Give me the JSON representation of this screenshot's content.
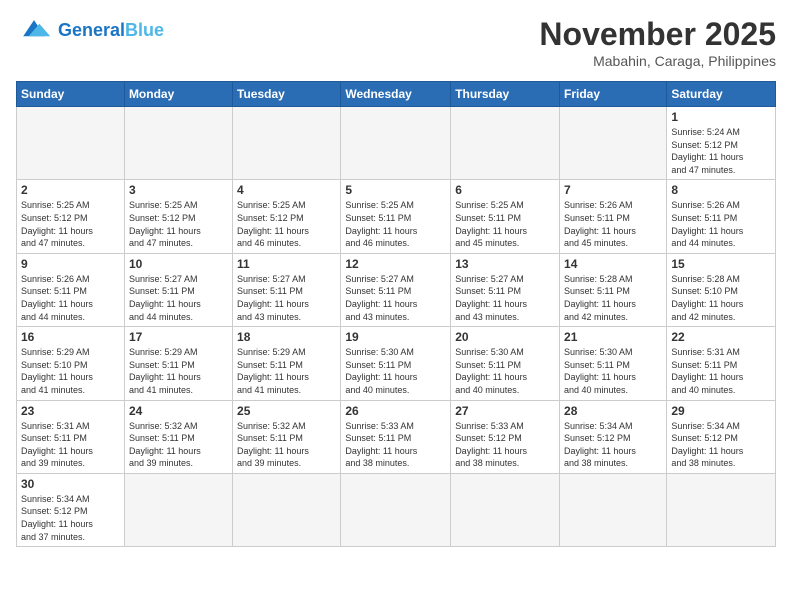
{
  "header": {
    "logo_general": "General",
    "logo_blue": "Blue",
    "month_title": "November 2025",
    "location": "Mabahin, Caraga, Philippines"
  },
  "weekdays": [
    "Sunday",
    "Monday",
    "Tuesday",
    "Wednesday",
    "Thursday",
    "Friday",
    "Saturday"
  ],
  "weeks": [
    [
      {
        "day": "",
        "info": ""
      },
      {
        "day": "",
        "info": ""
      },
      {
        "day": "",
        "info": ""
      },
      {
        "day": "",
        "info": ""
      },
      {
        "day": "",
        "info": ""
      },
      {
        "day": "",
        "info": ""
      },
      {
        "day": "1",
        "info": "Sunrise: 5:24 AM\nSunset: 5:12 PM\nDaylight: 11 hours\nand 47 minutes."
      }
    ],
    [
      {
        "day": "2",
        "info": "Sunrise: 5:25 AM\nSunset: 5:12 PM\nDaylight: 11 hours\nand 47 minutes."
      },
      {
        "day": "3",
        "info": "Sunrise: 5:25 AM\nSunset: 5:12 PM\nDaylight: 11 hours\nand 47 minutes."
      },
      {
        "day": "4",
        "info": "Sunrise: 5:25 AM\nSunset: 5:12 PM\nDaylight: 11 hours\nand 46 minutes."
      },
      {
        "day": "5",
        "info": "Sunrise: 5:25 AM\nSunset: 5:11 PM\nDaylight: 11 hours\nand 46 minutes."
      },
      {
        "day": "6",
        "info": "Sunrise: 5:25 AM\nSunset: 5:11 PM\nDaylight: 11 hours\nand 45 minutes."
      },
      {
        "day": "7",
        "info": "Sunrise: 5:26 AM\nSunset: 5:11 PM\nDaylight: 11 hours\nand 45 minutes."
      },
      {
        "day": "8",
        "info": "Sunrise: 5:26 AM\nSunset: 5:11 PM\nDaylight: 11 hours\nand 44 minutes."
      }
    ],
    [
      {
        "day": "9",
        "info": "Sunrise: 5:26 AM\nSunset: 5:11 PM\nDaylight: 11 hours\nand 44 minutes."
      },
      {
        "day": "10",
        "info": "Sunrise: 5:27 AM\nSunset: 5:11 PM\nDaylight: 11 hours\nand 44 minutes."
      },
      {
        "day": "11",
        "info": "Sunrise: 5:27 AM\nSunset: 5:11 PM\nDaylight: 11 hours\nand 43 minutes."
      },
      {
        "day": "12",
        "info": "Sunrise: 5:27 AM\nSunset: 5:11 PM\nDaylight: 11 hours\nand 43 minutes."
      },
      {
        "day": "13",
        "info": "Sunrise: 5:27 AM\nSunset: 5:11 PM\nDaylight: 11 hours\nand 43 minutes."
      },
      {
        "day": "14",
        "info": "Sunrise: 5:28 AM\nSunset: 5:11 PM\nDaylight: 11 hours\nand 42 minutes."
      },
      {
        "day": "15",
        "info": "Sunrise: 5:28 AM\nSunset: 5:10 PM\nDaylight: 11 hours\nand 42 minutes."
      }
    ],
    [
      {
        "day": "16",
        "info": "Sunrise: 5:29 AM\nSunset: 5:10 PM\nDaylight: 11 hours\nand 41 minutes."
      },
      {
        "day": "17",
        "info": "Sunrise: 5:29 AM\nSunset: 5:11 PM\nDaylight: 11 hours\nand 41 minutes."
      },
      {
        "day": "18",
        "info": "Sunrise: 5:29 AM\nSunset: 5:11 PM\nDaylight: 11 hours\nand 41 minutes."
      },
      {
        "day": "19",
        "info": "Sunrise: 5:30 AM\nSunset: 5:11 PM\nDaylight: 11 hours\nand 40 minutes."
      },
      {
        "day": "20",
        "info": "Sunrise: 5:30 AM\nSunset: 5:11 PM\nDaylight: 11 hours\nand 40 minutes."
      },
      {
        "day": "21",
        "info": "Sunrise: 5:30 AM\nSunset: 5:11 PM\nDaylight: 11 hours\nand 40 minutes."
      },
      {
        "day": "22",
        "info": "Sunrise: 5:31 AM\nSunset: 5:11 PM\nDaylight: 11 hours\nand 40 minutes."
      }
    ],
    [
      {
        "day": "23",
        "info": "Sunrise: 5:31 AM\nSunset: 5:11 PM\nDaylight: 11 hours\nand 39 minutes."
      },
      {
        "day": "24",
        "info": "Sunrise: 5:32 AM\nSunset: 5:11 PM\nDaylight: 11 hours\nand 39 minutes."
      },
      {
        "day": "25",
        "info": "Sunrise: 5:32 AM\nSunset: 5:11 PM\nDaylight: 11 hours\nand 39 minutes."
      },
      {
        "day": "26",
        "info": "Sunrise: 5:33 AM\nSunset: 5:11 PM\nDaylight: 11 hours\nand 38 minutes."
      },
      {
        "day": "27",
        "info": "Sunrise: 5:33 AM\nSunset: 5:12 PM\nDaylight: 11 hours\nand 38 minutes."
      },
      {
        "day": "28",
        "info": "Sunrise: 5:34 AM\nSunset: 5:12 PM\nDaylight: 11 hours\nand 38 minutes."
      },
      {
        "day": "29",
        "info": "Sunrise: 5:34 AM\nSunset: 5:12 PM\nDaylight: 11 hours\nand 38 minutes."
      }
    ],
    [
      {
        "day": "30",
        "info": "Sunrise: 5:34 AM\nSunset: 5:12 PM\nDaylight: 11 hours\nand 37 minutes."
      },
      {
        "day": "",
        "info": ""
      },
      {
        "day": "",
        "info": ""
      },
      {
        "day": "",
        "info": ""
      },
      {
        "day": "",
        "info": ""
      },
      {
        "day": "",
        "info": ""
      },
      {
        "day": "",
        "info": ""
      }
    ]
  ]
}
